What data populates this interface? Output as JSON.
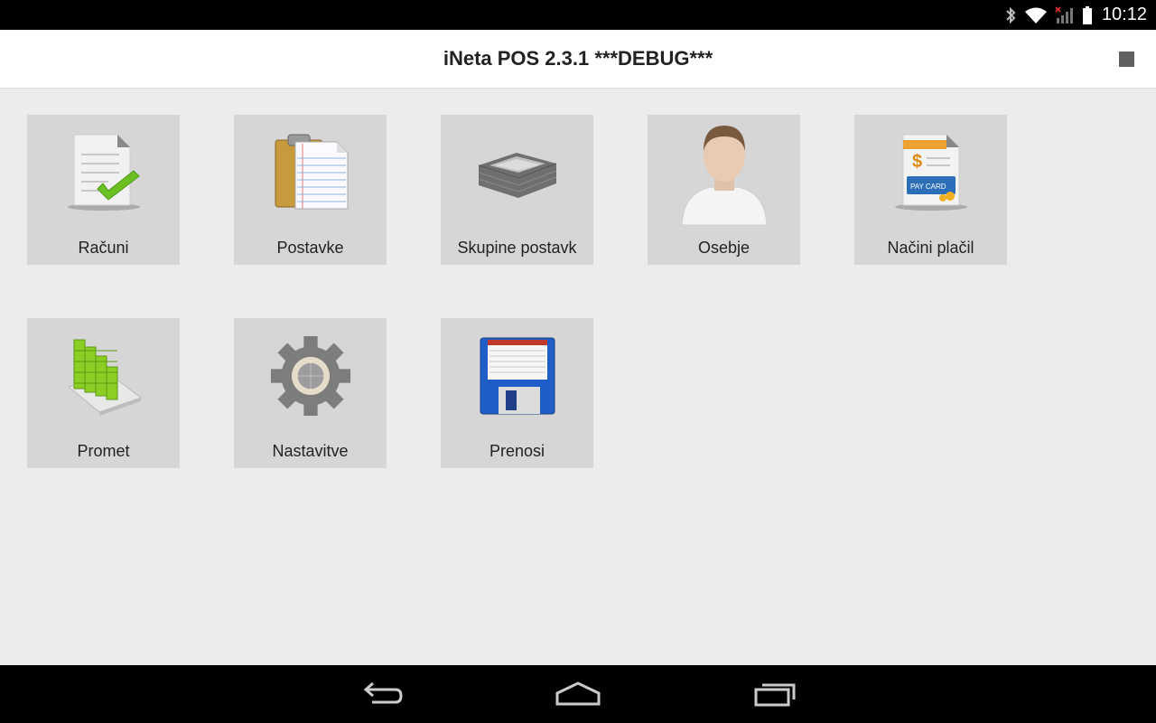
{
  "status_bar": {
    "time": "10:12",
    "icons": [
      "bluetooth-icon",
      "wifi-icon",
      "signal-icon",
      "battery-icon"
    ]
  },
  "action_bar": {
    "title": "iNeta POS 2.3.1 ***DEBUG***",
    "overflow_icon": "stop-square-icon"
  },
  "tiles": [
    {
      "label": "Računi",
      "icon": "receipt-check-icon"
    },
    {
      "label": "Postavke",
      "icon": "clipboard-list-icon"
    },
    {
      "label": "Skupine postavk",
      "icon": "tray-stack-icon"
    },
    {
      "label": "Osebje",
      "icon": "person-icon"
    },
    {
      "label": "Načini plačil",
      "icon": "payment-card-icon"
    },
    {
      "label": "Promet",
      "icon": "bar-chart-icon"
    },
    {
      "label": "Nastavitve",
      "icon": "gear-icon"
    },
    {
      "label": "Prenosi",
      "icon": "floppy-disk-icon"
    }
  ],
  "nav_bar": {
    "icons": [
      "back-icon",
      "home-icon",
      "recents-icon"
    ]
  }
}
